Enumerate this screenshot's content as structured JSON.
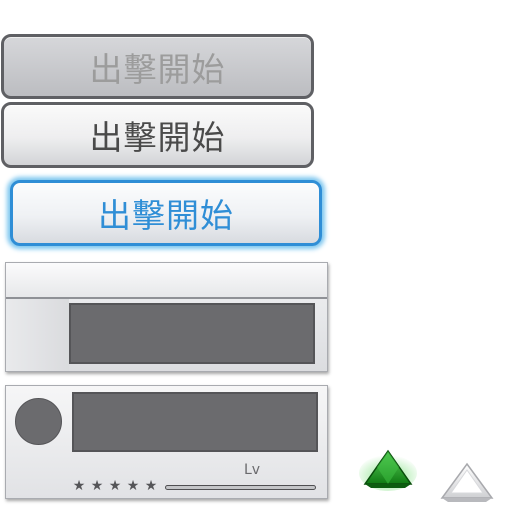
{
  "buttons": {
    "disabled_label": "出擊開始",
    "normal_label": "出擊開始",
    "hover_label": "出擊開始"
  },
  "character_card": {
    "level_label": "Lv",
    "star_glyph": "★",
    "star_count": 5,
    "exp_fraction": 0.0
  },
  "icons": {
    "green_triangle": "up-triangle-green-icon",
    "white_triangle": "up-triangle-white-icon"
  },
  "colors": {
    "accent_blue": "#2f8ed6",
    "glow_blue": "#7cc6ef",
    "border_dark": "#5f6064",
    "placeholder_gray": "#6b6b6e",
    "triangle_green": "#1f9a1f"
  }
}
